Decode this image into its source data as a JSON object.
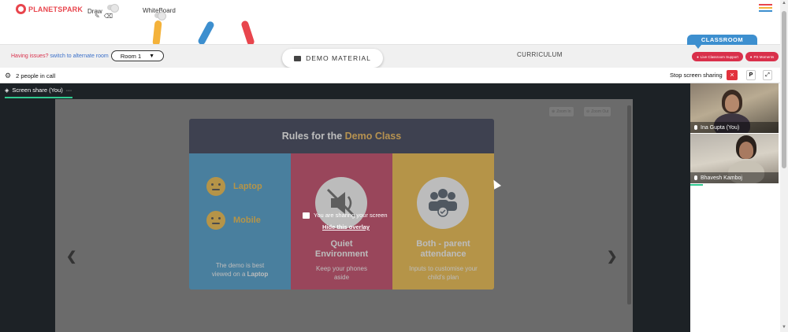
{
  "brand": {
    "logo_text": "PLANETSPARK",
    "accent": "#e8454d"
  },
  "toolbar": {
    "draw_label": "Draw",
    "draw_tools": [
      "pencil-icon",
      "eraser-icon"
    ],
    "whiteboard_label": "WhiteBoard",
    "menu_icon": "hamburger-menu-icon",
    "menu_colors": [
      "#e8454d",
      "#f4b23a",
      "#3d8fcf"
    ]
  },
  "roombar": {
    "issues_text": "Having issues?",
    "switch_link": "switch to alternate room",
    "room_selected": "Room 1",
    "demo_button": "DEMO MATERIAL",
    "curriculum_label": "CURRICULUM",
    "classroom_tab": "CLASSROOM",
    "live_support": "Live Classroom Support",
    "ps_moments": "PS Moments"
  },
  "call": {
    "people_count_text": "2 people in call",
    "stop_sharing": "Stop screen sharing",
    "close_symbol": "×",
    "p_button": "P",
    "expand_symbol": "⤢"
  },
  "stage": {
    "share_tab_label": "Screen share (You)",
    "share_tab_more": "···",
    "zoom_in": "Zoom In",
    "zoom_out": "Zoom Out",
    "prev_arrow": "❮",
    "next_arrow": "❯",
    "overlay_message": "You are sharing your screen",
    "hide_overlay": "Hide this overlay"
  },
  "slide": {
    "title_start": "Rules for the ",
    "title_highlight": "Demo Class",
    "col1": {
      "item1": "Laptop",
      "item2": "Mobile",
      "note_line1": "The demo is best",
      "note_prefix": "viewed on a ",
      "note_bold": "Laptop"
    },
    "col2": {
      "title_line1": "Quiet",
      "title_line2": "Environment",
      "note_line1": "Keep your phones",
      "note_line2": "aside"
    },
    "col3": {
      "title_line1": "Both - parent",
      "title_line2": "attendance",
      "note_line1": "Inputs to customise your",
      "note_line2": "child's plan"
    },
    "colors": {
      "header": "#1a1f3a",
      "blue": "#2e90c8",
      "red": "#c0284e",
      "yellow": "#f2b72c"
    }
  },
  "participants": [
    {
      "name": "Ina Gupta (You)",
      "mic": "mic-icon"
    },
    {
      "name": "Bhavesh Kamboj",
      "mic": "mic-icon"
    }
  ]
}
